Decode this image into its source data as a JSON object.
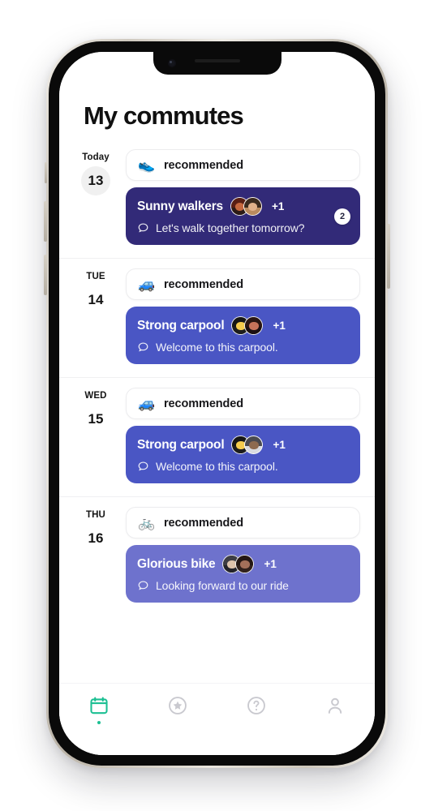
{
  "app": {
    "title": "My commutes"
  },
  "colors": {
    "accent_active": "#1bbf92",
    "card_deep_indigo": "#322a78",
    "card_blue": "#4a56c4",
    "card_periwinkle": "#6e72cd",
    "today_pill_bg": "#f0f0f0",
    "inactive_icon": "#c9c9cf"
  },
  "days": [
    {
      "day_label": "Today",
      "date_number": "13",
      "is_today": true,
      "recommendation": {
        "icon": "running-shoe-icon",
        "glyph": "👟",
        "label": "recommended"
      },
      "commute": {
        "name": "Sunny walkers",
        "extra_members": "+1",
        "message": "Let's walk together tomorrow?",
        "badge": "2",
        "has_badge": true,
        "card_color": "#322a78",
        "avatars": [
          {
            "name": "avatar-participant-1",
            "hair": "#5a1f14",
            "face": "#c6683f",
            "body": "#2c1b16"
          },
          {
            "name": "avatar-participant-2",
            "hair": "#3a2a1e",
            "face": "#e0b08a",
            "body": "#b98a5e"
          }
        ]
      }
    },
    {
      "day_label": "TUE",
      "date_number": "14",
      "is_today": false,
      "recommendation": {
        "icon": "car-icon",
        "glyph": "🚙",
        "label": "recommended"
      },
      "commute": {
        "name": "Strong carpool",
        "extra_members": "+1",
        "message": "Welcome to this carpool.",
        "badge": "",
        "has_badge": false,
        "card_color": "#4a56c4",
        "avatars": [
          {
            "name": "avatar-participant-1",
            "hair": "#161616",
            "face": "#f5cc4e",
            "body": "#1d1d1d"
          },
          {
            "name": "avatar-participant-2",
            "hair": "#2a1512",
            "face": "#c8735a",
            "body": "#1b1012"
          }
        ]
      }
    },
    {
      "day_label": "WED",
      "date_number": "15",
      "is_today": false,
      "recommendation": {
        "icon": "car-icon",
        "glyph": "🚙",
        "label": "recommended"
      },
      "commute": {
        "name": "Strong carpool",
        "extra_members": "+1",
        "message": "Welcome to this carpool.",
        "badge": "",
        "has_badge": false,
        "card_color": "#4a56c4",
        "avatars": [
          {
            "name": "avatar-participant-1",
            "hair": "#161616",
            "face": "#f5cc4e",
            "body": "#1d1d1d"
          },
          {
            "name": "avatar-participant-2",
            "hair": "#4a4a50",
            "face": "#8d6a4f",
            "body": "#d9dbe0"
          }
        ]
      }
    },
    {
      "day_label": "THU",
      "date_number": "16",
      "is_today": false,
      "recommendation": {
        "icon": "bicycle-icon",
        "glyph": "🚲",
        "label": "recommended"
      },
      "commute": {
        "name": "Glorious bike",
        "extra_members": "+1",
        "message": "Looking forward to our ride",
        "badge": "",
        "has_badge": false,
        "card_color": "#6e72cd",
        "avatars": [
          {
            "name": "avatar-participant-1",
            "hair": "#3d3d44",
            "face": "#ddc3ac",
            "body": "#23232a"
          },
          {
            "name": "avatar-participant-2",
            "hair": "#241714",
            "face": "#a3705a",
            "body": "#31211c"
          }
        ]
      }
    }
  ],
  "tabbar": [
    {
      "name": "tab-calendar",
      "icon": "calendar-icon",
      "active": true
    },
    {
      "name": "tab-favorites",
      "icon": "star-circle-icon",
      "active": false
    },
    {
      "name": "tab-help",
      "icon": "question-circle-icon",
      "active": false
    },
    {
      "name": "tab-profile",
      "icon": "person-icon",
      "active": false
    }
  ]
}
